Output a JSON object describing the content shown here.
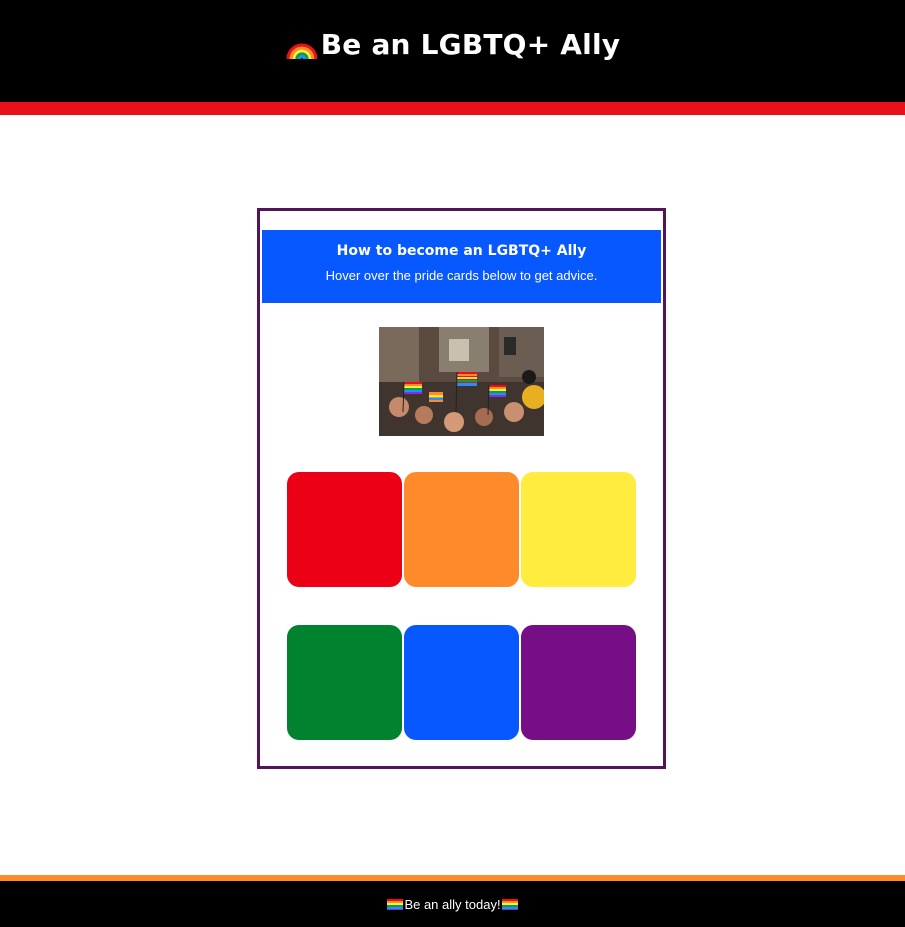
{
  "header": {
    "title": "Be an LGBTQ+ Ally",
    "icon": "rainbow-icon",
    "stripe_color": "#e8101a"
  },
  "card": {
    "title": "How to become an LGBTQ+ Ally",
    "subtitle": "Hover over the pride cards below to get advice.",
    "banner_color": "#0758ff",
    "border_color": "#531557",
    "photo_icon": "pride-parade-photo",
    "tiles": [
      {
        "name": "red",
        "color": "#ec0016"
      },
      {
        "name": "orange",
        "color": "#ff8a2a"
      },
      {
        "name": "yellow",
        "color": "#ffec3e"
      },
      {
        "name": "green",
        "color": "#00822f"
      },
      {
        "name": "blue",
        "color": "#0758ff"
      },
      {
        "name": "purple",
        "color": "#760f86"
      }
    ]
  },
  "footer": {
    "text": "Be an ally today!",
    "icon": "pride-flag-icon",
    "stripe_color": "#ff8a2a"
  }
}
